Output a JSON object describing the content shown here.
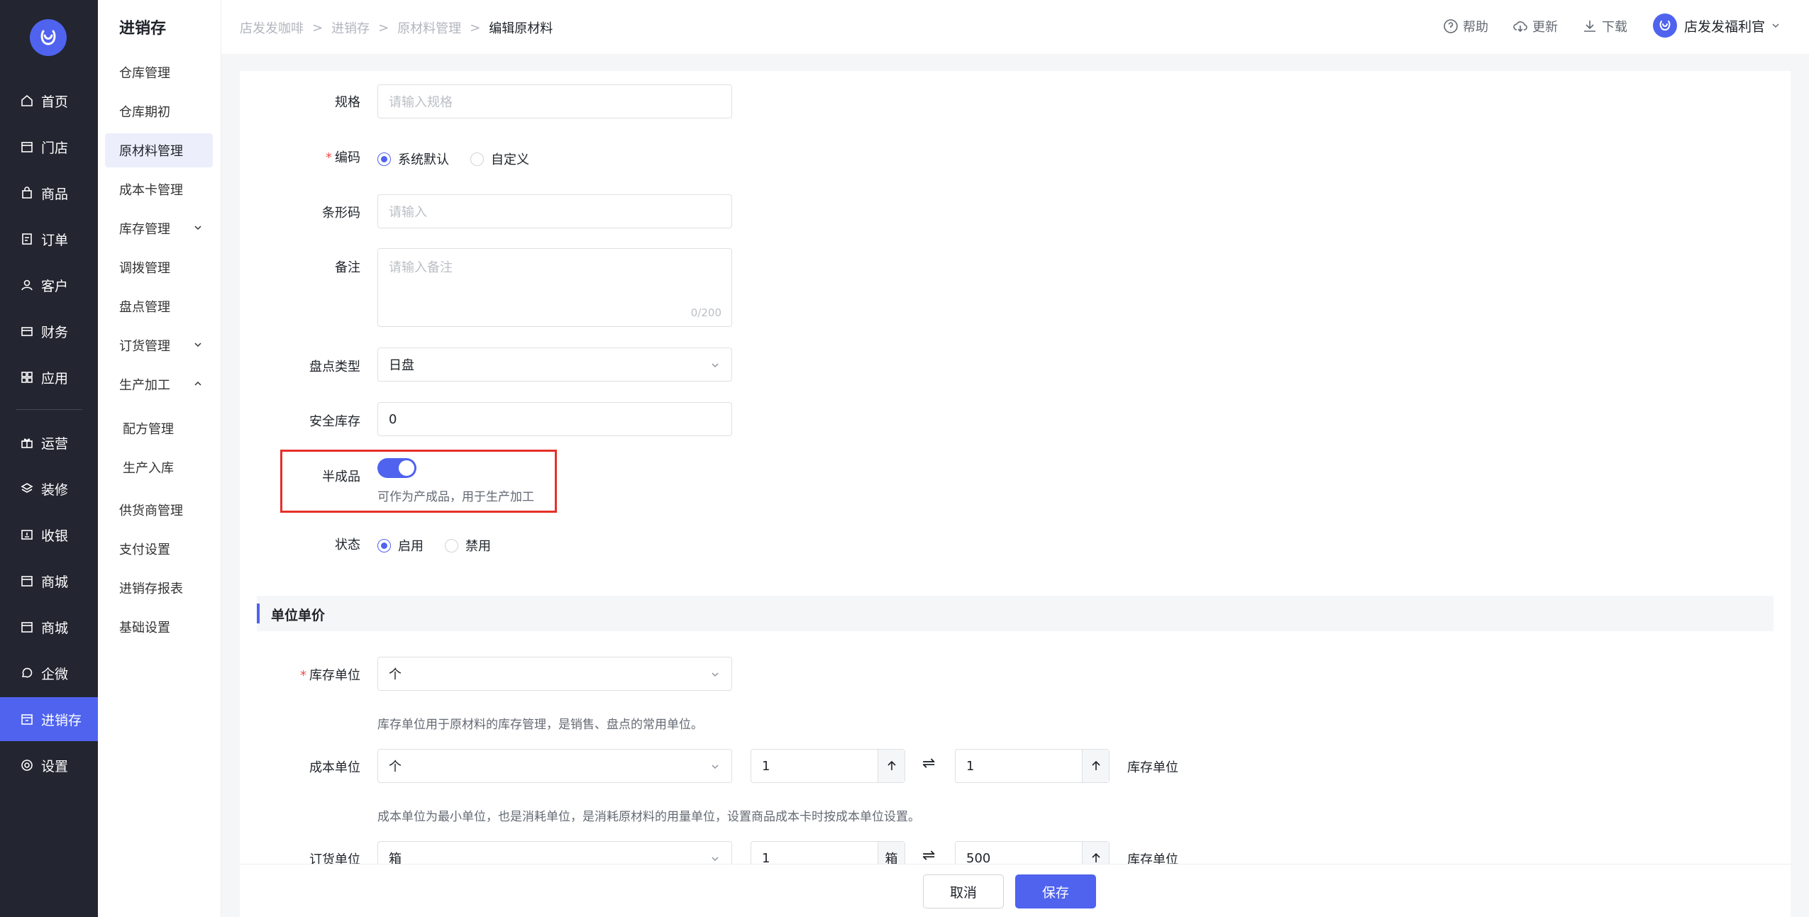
{
  "nav": {
    "items": [
      {
        "label": "首页",
        "icon": "home-icon"
      },
      {
        "label": "门店",
        "icon": "store-icon"
      },
      {
        "label": "商品",
        "icon": "bag-icon"
      },
      {
        "label": "订单",
        "icon": "order-icon"
      },
      {
        "label": "客户",
        "icon": "user-icon"
      },
      {
        "label": "财务",
        "icon": "wallet-icon"
      },
      {
        "label": "应用",
        "icon": "apps-icon"
      },
      {
        "label": "运营",
        "icon": "gift-icon"
      },
      {
        "label": "装修",
        "icon": "layers-icon"
      },
      {
        "label": "收银",
        "icon": "cashier-icon"
      },
      {
        "label": "商城",
        "icon": "store-icon"
      },
      {
        "label": "商城",
        "icon": "store-icon"
      },
      {
        "label": "企微",
        "icon": "chat-icon"
      },
      {
        "label": "进销存",
        "icon": "inventory-icon"
      },
      {
        "label": "设置",
        "icon": "gear-icon"
      }
    ],
    "active_index": 13
  },
  "submenu": {
    "title": "进销存",
    "items": [
      {
        "label": "仓库管理"
      },
      {
        "label": "仓库期初"
      },
      {
        "label": "原材料管理"
      },
      {
        "label": "成本卡管理"
      },
      {
        "label": "库存管理"
      },
      {
        "label": "调拨管理"
      },
      {
        "label": "盘点管理"
      },
      {
        "label": "订货管理"
      },
      {
        "label": "生产加工"
      },
      {
        "label": "配方管理"
      },
      {
        "label": "生产入库"
      },
      {
        "label": "供货商管理"
      },
      {
        "label": "支付设置"
      },
      {
        "label": "进销存报表"
      },
      {
        "label": "基础设置"
      }
    ]
  },
  "breadcrumb": [
    "店发发咖啡",
    "进销存",
    "原材料管理",
    "编辑原材料"
  ],
  "topbar": {
    "help": "帮助",
    "update": "更新",
    "download": "下载",
    "user_name": "店发发福利官"
  },
  "form": {
    "spec": {
      "label": "规格",
      "placeholder": "请输入规格"
    },
    "code": {
      "label": "编码",
      "options": [
        "系统默认",
        "自定义"
      ],
      "selected": "系统默认"
    },
    "barcode": {
      "label": "条形码",
      "placeholder": "请输入"
    },
    "remark": {
      "label": "备注",
      "placeholder": "请输入备注",
      "count": "0/200"
    },
    "check_type": {
      "label": "盘点类型",
      "value": "日盘"
    },
    "safety_stock": {
      "label": "安全库存",
      "value": "0"
    },
    "semi_product": {
      "label": "半成品",
      "enabled": true,
      "hint": "可作为产成品，用于生产加工"
    },
    "status": {
      "label": "状态",
      "options": [
        "启用",
        "禁用"
      ],
      "selected": "启用"
    }
  },
  "unit_section": {
    "title": "单位单价",
    "stock_unit": {
      "label": "库存单位",
      "value": "个",
      "hint": "库存单位用于原材料的库存管理，是销售、盘点的常用单位。"
    },
    "cost_unit": {
      "label": "成本单位",
      "value": "个",
      "qty_left": "1",
      "qty_right": "1",
      "right_unit": "库存单位",
      "hint": "成本单位为最小单位，也是消耗单位，是消耗原材料的用量单位，设置商品成本卡时按成本单位设置。"
    },
    "order_unit": {
      "label": "订货单位",
      "value": "箱",
      "qty_left": "1",
      "left_addon": "箱",
      "qty_right": "500",
      "right_unit": "库存单位"
    },
    "swap_symbol": "⇌"
  },
  "footer": {
    "cancel": "取消",
    "save": "保存"
  },
  "colors": {
    "accent": "#4f63ef",
    "nav_bg": "#232530",
    "highlight": "#e5302a"
  }
}
